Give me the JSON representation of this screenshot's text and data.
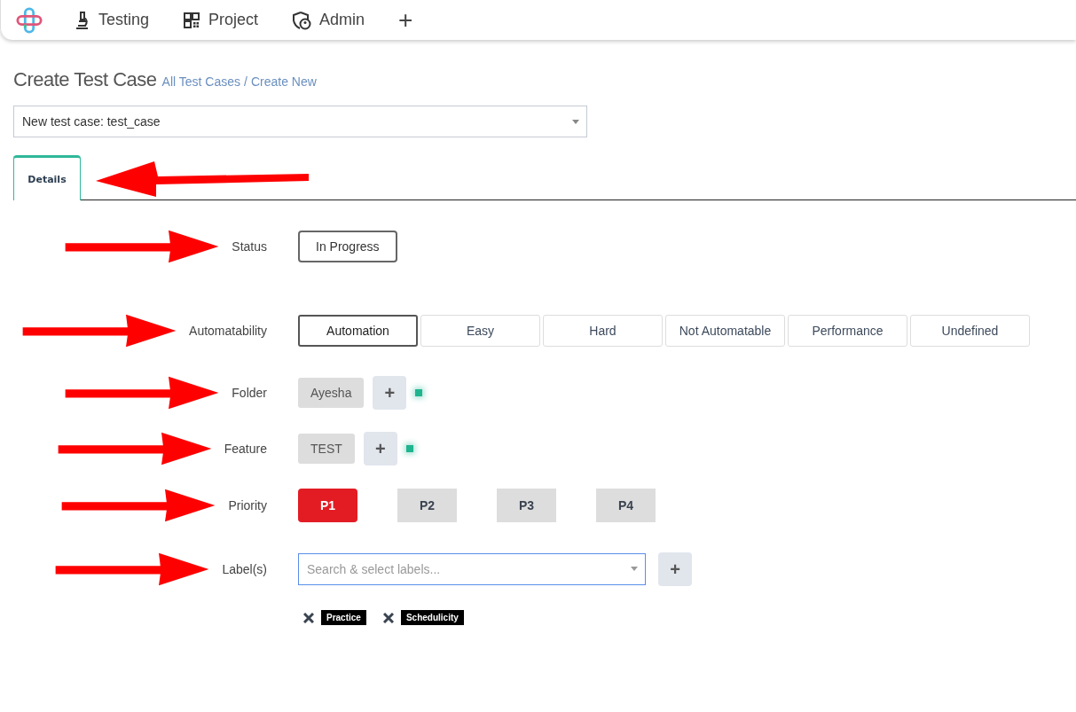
{
  "nav": {
    "items": [
      {
        "label": "Testing",
        "kind": "microscope"
      },
      {
        "label": "Project",
        "kind": "qr"
      },
      {
        "label": "Admin",
        "kind": "shield"
      }
    ],
    "add": "+"
  },
  "header": {
    "title": "Create Test Case",
    "breadcrumb": [
      {
        "label": "All Test Cases"
      },
      {
        "label": "Create New"
      }
    ],
    "separator": "/"
  },
  "test_case_select": {
    "value": "New test case: test_case"
  },
  "tabs": [
    {
      "label": "Details",
      "selected": true
    }
  ],
  "form": {
    "status": {
      "label": "Status",
      "value": "In Progress"
    },
    "automatability": {
      "label": "Automatability",
      "options": [
        {
          "label": "Automation",
          "selected": true
        },
        {
          "label": "Easy",
          "selected": false
        },
        {
          "label": "Hard",
          "selected": false
        },
        {
          "label": "Not Automatable",
          "selected": false
        },
        {
          "label": "Performance",
          "selected": false
        },
        {
          "label": "Undefined",
          "selected": false
        }
      ]
    },
    "folder": {
      "label": "Folder",
      "value": "Ayesha",
      "add": "+"
    },
    "feature": {
      "label": "Feature",
      "value": "TEST",
      "add": "+"
    },
    "priority": {
      "label": "Priority",
      "options": [
        {
          "label": "P1",
          "selected": true
        },
        {
          "label": "P2",
          "selected": false
        },
        {
          "label": "P3",
          "selected": false
        },
        {
          "label": "P4",
          "selected": false
        }
      ]
    },
    "labels": {
      "label": "Label(s)",
      "placeholder": "Search & select labels...",
      "add": "+",
      "tags": [
        {
          "label": "Practice"
        },
        {
          "label": "Schedulicity"
        }
      ]
    }
  }
}
